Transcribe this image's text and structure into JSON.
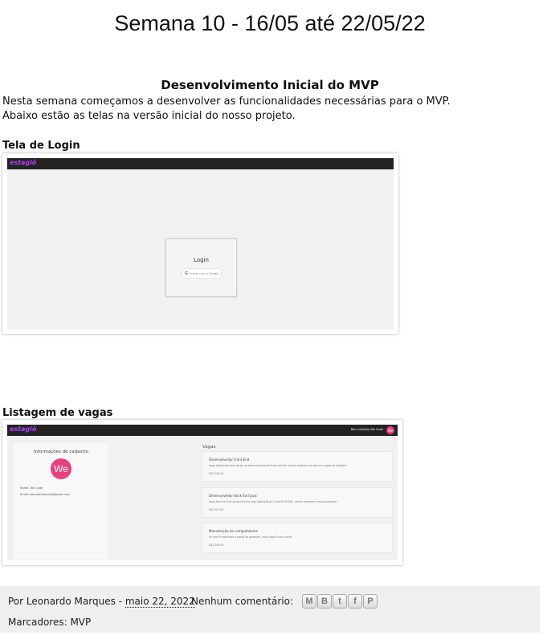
{
  "page_title": "Semana 10 - 16/05 até 22/05/22",
  "post": {
    "heading": "Desenvolvimento Inicial do MVP",
    "intro_line1": "Nesta semana começamos a desenvolver as funcionalidades necessárias para o MVP.",
    "intro_line2": "Abaixo estão as telas na versão inicial do nosso projeto.",
    "sections": [
      {
        "label": "Tela de Login",
        "app_logo": "estagiô",
        "login_title": "Login",
        "google_button": "Entrar com o Google"
      },
      {
        "label": "Listagem de vagas",
        "app_logo": "estagiô",
        "greeting": "Bem vindo(a) We Code",
        "avatar_initials": "We",
        "profile_title": "Informações de cadastro",
        "profile_name": "Nome: We Code",
        "profile_email": "Email: wecodetrabalho@gmail.com",
        "vagas_title": "Vagas",
        "jobs": [
          {
            "title": "Desenvolvedor Front End",
            "desc": "Vaga disponível para atuar no desenvolvimento front end de nossos sistemas focado em vagas de estágio!",
            "salary": "R$2.000,00"
          },
          {
            "title": "Desenvolvedor Back End Java",
            "desc": "Vaga back end de aprendiz Java com Spring Boot e Oracle PL/SQL, venha conhecer nossos projetos!",
            "salary": "R$1.507,00"
          },
          {
            "title": "Manutenção de computadores",
            "desc": "Se você é dedicado a gosta de aprender, essa vaga é para você!",
            "salary": "R$1.200,00"
          }
        ]
      }
    ]
  },
  "footer": {
    "byline_prefix": "Por Leonardo Marques - ",
    "date": "maio 22, 2022",
    "comments": "Nenhum comentário:",
    "share_icons": [
      "email-icon",
      "blogger-icon",
      "twitter-icon",
      "facebook-icon",
      "pinterest-icon"
    ],
    "labels_prefix": "Marcadores: ",
    "label": "MVP"
  }
}
